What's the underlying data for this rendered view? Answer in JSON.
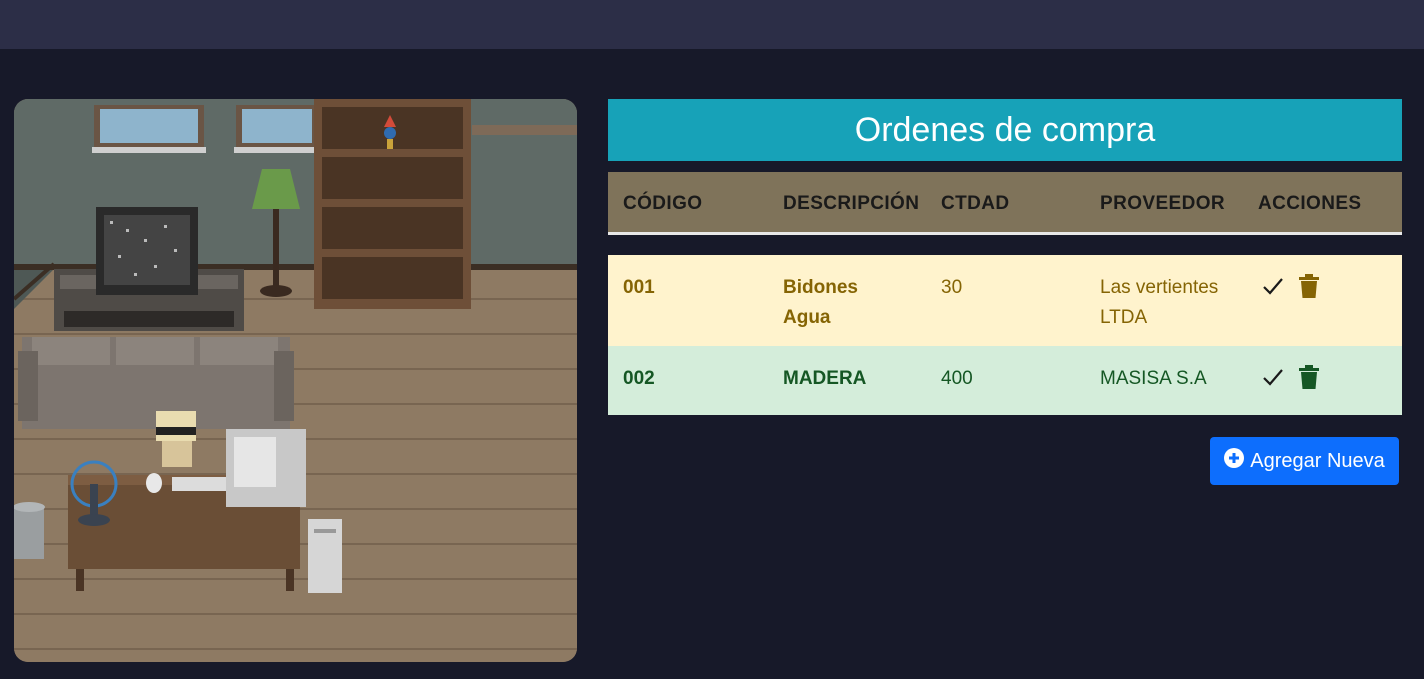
{
  "page": {
    "title": "Ordenes de compra"
  },
  "table": {
    "headers": [
      "CÓDIGO",
      "DESCRIPCIÓN",
      "CTDAD",
      "PROVEEDOR",
      "ACCIONES"
    ],
    "rows": [
      {
        "codigo": "001",
        "descripcion_1": "Bidones",
        "descripcion_2": "Agua",
        "ctdad": "30",
        "proveedor_1": "Las vertientes",
        "proveedor_2": "LTDA",
        "status": "warning"
      },
      {
        "codigo": "002",
        "descripcion_1": "MADERA",
        "descripcion_2": "",
        "ctdad": "400",
        "proveedor_1": "MASISA S.A",
        "proveedor_2": "",
        "status": "success"
      }
    ]
  },
  "actions": {
    "add_label": "Agregar Nueva"
  },
  "icons": {
    "approve": "check-icon",
    "delete": "trash-icon",
    "add": "plus-circle-icon"
  },
  "colors": {
    "header": "#17a2b8",
    "warning_row": "#fff3cd",
    "success_row": "#d4edda",
    "button": "#0d6efd"
  }
}
